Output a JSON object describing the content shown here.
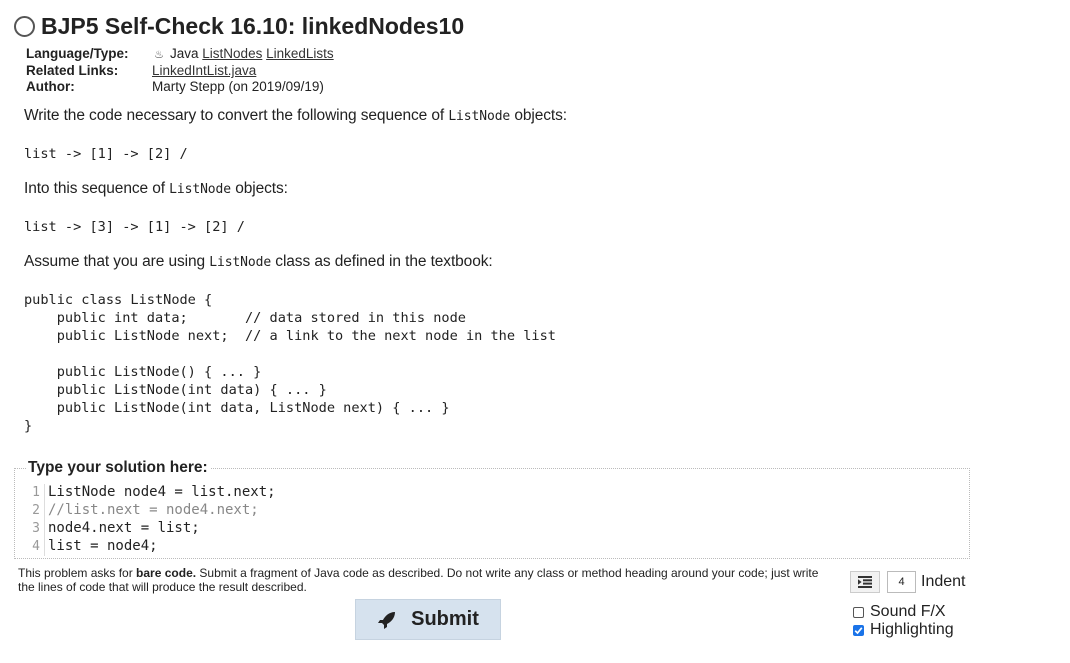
{
  "title": "BJP5 Self-Check 16.10: linkedNodes10",
  "meta": {
    "language_key": "Language/Type:",
    "language_value": "Java",
    "tags": [
      "ListNodes",
      "LinkedLists"
    ],
    "related_key": "Related Links:",
    "related_link": "LinkedIntList.java",
    "author_key": "Author:",
    "author_value": "Marty Stepp (on 2019/09/19)"
  },
  "prompt": {
    "p1_before": "Write the code necessary to convert the following sequence of",
    "p1_code": "ListNode",
    "p1_after": "objects:",
    "seq1": "list -> [1] -> [2] /",
    "p2_before": "Into this sequence of",
    "p2_code": "ListNode",
    "p2_after": "objects:",
    "seq2": "list -> [3] -> [1] -> [2] /",
    "p3_before": "Assume that you are using",
    "p3_code": "ListNode",
    "p3_after": "class as defined in the textbook:",
    "class_code": "public class ListNode {\n    public int data;       // data stored in this node\n    public ListNode next;  // a link to the next node in the list\n\n    public ListNode() { ... }\n    public ListNode(int data) { ... }\n    public ListNode(int data, ListNode next) { ... }\n}"
  },
  "solution": {
    "legend": "Type your solution here:",
    "lines": [
      {
        "num": "1",
        "text": "ListNode node4 = list.next;"
      },
      {
        "num": "2",
        "text": "//list.next = node4.next;"
      },
      {
        "num": "3",
        "text": "node4.next = list;"
      },
      {
        "num": "4",
        "text": "list = node4;"
      }
    ]
  },
  "instructions": {
    "before": "This problem asks for",
    "bold": "bare code.",
    "after": "Submit a fragment of Java code as described. Do not write any class or method heading around your code; just write the lines of code that will produce the result described."
  },
  "controls": {
    "submit_label": "Submit",
    "indent_value": "4",
    "indent_label": "Indent",
    "sound_label": "Sound F/X",
    "sound_checked": false,
    "highlighting_label": "Highlighting",
    "highlighting_checked": true
  },
  "colors": {
    "submit_bg": "#d6e2ee",
    "checkbox_on": "#1a73e8"
  },
  "icons": [
    "status-circle-icon",
    "java-icon",
    "rocket-icon",
    "indent-icon"
  ]
}
